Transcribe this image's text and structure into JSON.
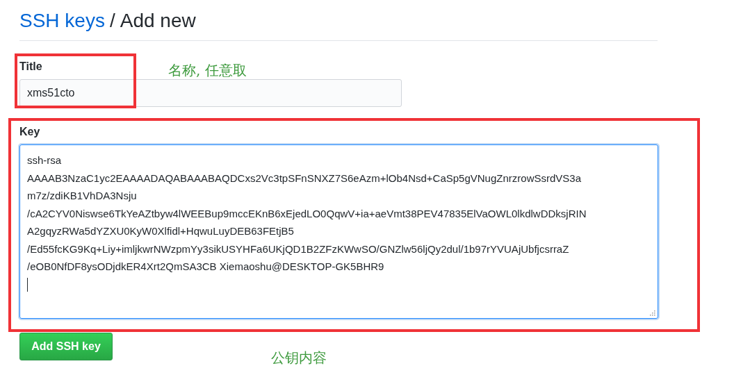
{
  "heading": {
    "link": "SSH keys",
    "separator": "/",
    "current": "Add new"
  },
  "title_field": {
    "label": "Title",
    "value": "xms51cto"
  },
  "key_field": {
    "label": "Key",
    "lines": [
      "ssh-rsa",
      "AAAAB3NzaC1yc2EAAAADAQABAAABAQDCxs2Vc3tpSFnSNXZ7S6eAzm+lOb4Nsd+CaSp5gVNugZnrzrowSsrdVS3a",
      "m7z/zdiKB1VhDA3Nsju",
      "/cA2CYV0Niswse6TkYeAZtbyw4lWEEBup9mccEKnB6xEjedLO0QqwV+ia+aeVmt38PEV47835ElVaOWL0lkdlwDDksjRIN",
      "A2gqyzRWa5dYZXU0KyW0Xlfidl+HqwuLuyDEB63FEtjB5",
      "/Ed55fcKG9Kq+Liy+imljkwrNWzpmYy3sikUSYHFa6UKjQD1B2ZFzKWwSO/GNZlw56ljQy2dul/1b97rYVUAjUbfjcsrraZ",
      "/eOB0NfDF8ysODjdkER4Xrt2QmSA3CB Xiemaoshu@DESKTOP-GK5BHR9"
    ],
    "focused": true
  },
  "submit_button": "Add SSH key",
  "annotations": [
    {
      "text": "名称, 任意取"
    },
    {
      "text": "公钥内容"
    }
  ]
}
